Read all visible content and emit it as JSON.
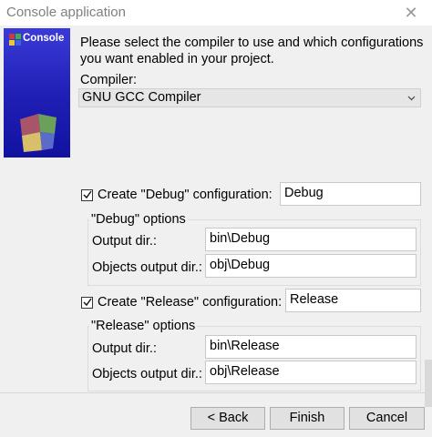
{
  "window": {
    "title": "Console application",
    "close_glyph": "✕"
  },
  "banner": {
    "label": "Console",
    "icon": "console-wizard-icon"
  },
  "intro_text": "Please select the compiler to use and which configurations you want enabled in your project.",
  "compiler": {
    "label": "Compiler:",
    "selected": "GNU GCC Compiler"
  },
  "debug": {
    "checkbox_label": "Create \"Debug\" configuration:",
    "checked": true,
    "name": "Debug",
    "group_title": "\"Debug\" options",
    "output_label": "Output dir.:",
    "output_value": "bin\\Debug",
    "objects_label": "Objects output dir.:",
    "objects_value": "obj\\Debug"
  },
  "release": {
    "checkbox_label": "Create \"Release\" configuration:",
    "checked": true,
    "name": "Release",
    "group_title": "\"Release\" options",
    "output_label": "Output dir.:",
    "output_value": "bin\\Release",
    "objects_label": "Objects output dir.:",
    "objects_value": "obj\\Release"
  },
  "buttons": {
    "back": "< Back",
    "finish": "Finish",
    "cancel": "Cancel"
  },
  "colors": {
    "banner": "#2525c0",
    "window_bg": "#f0f0f0"
  }
}
